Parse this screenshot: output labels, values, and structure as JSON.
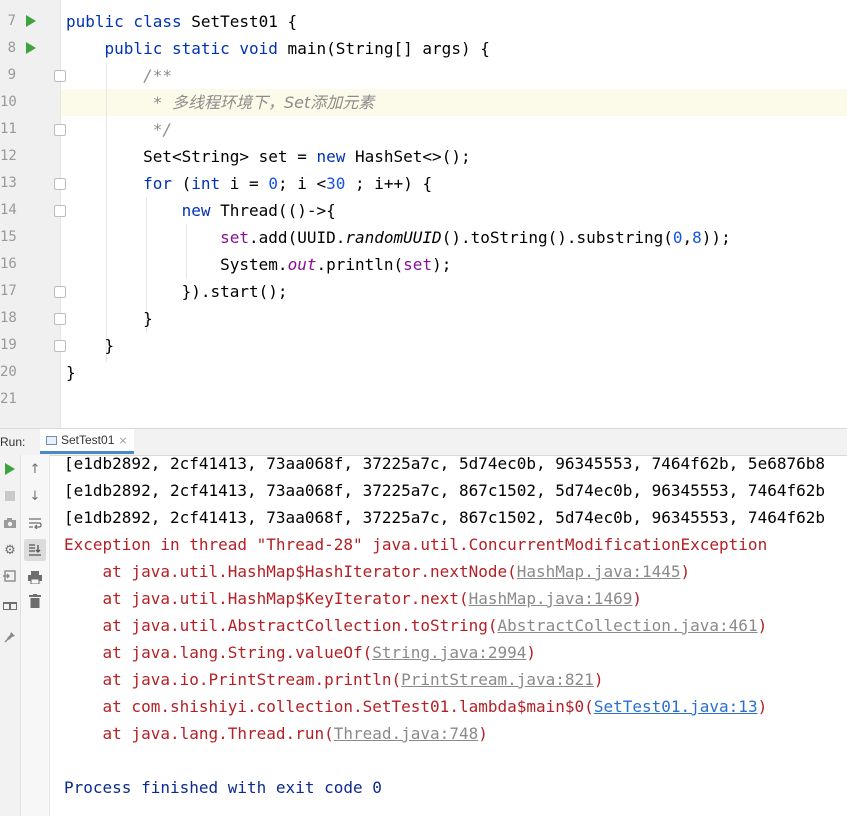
{
  "editor": {
    "line_numbers": [
      "7",
      "8",
      "9",
      "10",
      "11",
      "12",
      "13",
      "14",
      "15",
      "16",
      "17",
      "18",
      "19",
      "20",
      "21"
    ],
    "code": {
      "l7": {
        "k1": "public class",
        "t": " SetTest01 {"
      },
      "l8": {
        "k1": "public static void",
        "t1": " main(String[] args) {"
      },
      "l9": {
        "c": "/**"
      },
      "l10": {
        "c1": " * ",
        "c2": "多线程环境下，Set添加元素"
      },
      "l11": {
        "c": " */"
      },
      "l12": {
        "t1": "Set<String> set = ",
        "k": "new",
        "t2": " HashSet<>();"
      },
      "l13": {
        "k1": "for",
        "t1": " (",
        "k2": "int",
        "t2": " i = ",
        "n1": "0",
        "t3": "; i <",
        "n2": "30",
        "t4": " ; i++) {"
      },
      "l14": {
        "k": "new",
        "t": " Thread(()->{"
      },
      "l15": {
        "f": "set",
        "t1": ".add(UUID.",
        "i": "randomUUID",
        "t2": "().toString().substring(",
        "n1": "0",
        "t3": ",",
        "n2": "8",
        "t4": "));"
      },
      "l16": {
        "t1": "System.",
        "f": "out",
        "t2": ".println(",
        "f2": "set",
        "t3": ");"
      },
      "l17": {
        "t": "}).start();"
      },
      "l18": {
        "t": "}"
      },
      "l19": {
        "t": "}"
      },
      "l20": {
        "t": "}"
      }
    }
  },
  "run": {
    "label": "Run:",
    "tab_name": "SetTest01",
    "tab_close": "×"
  },
  "console": {
    "out1": "[e1db2892, 2cf41413, 73aa068f, 37225a7c, 5d74ec0b, 96345553, 7464f62b, 5e6876b8",
    "out2": "[e1db2892, 2cf41413, 73aa068f, 37225a7c, 867c1502, 5d74ec0b, 96345553, 7464f62b",
    "out3": "[e1db2892, 2cf41413, 73aa068f, 37225a7c, 867c1502, 5d74ec0b, 96345553, 7464f62b",
    "exception": "Exception in thread \"Thread-28\" java.util.ConcurrentModificationException",
    "stack": [
      {
        "pre": "    at java.util.HashMap$HashIterator.nextNode(",
        "link": "HashMap.java:1445",
        "post": ")"
      },
      {
        "pre": "    at java.util.HashMap$KeyIterator.next(",
        "link": "HashMap.java:1469",
        "post": ")"
      },
      {
        "pre": "    at java.util.AbstractCollection.toString(",
        "link": "AbstractCollection.java:461",
        "post": ")"
      },
      {
        "pre": "    at java.lang.String.valueOf(",
        "link": "String.java:2994",
        "post": ")"
      },
      {
        "pre": "    at java.io.PrintStream.println(",
        "link": "PrintStream.java:821",
        "post": ")"
      },
      {
        "pre": "    at com.shishiyi.collection.SetTest01.lambda$main$0(",
        "link": "SetTest01.java:13",
        "post": ")"
      },
      {
        "pre": "    at java.lang.Thread.run(",
        "link": "Thread.java:748",
        "post": ")"
      }
    ],
    "finished": "Process finished with exit code 0"
  }
}
